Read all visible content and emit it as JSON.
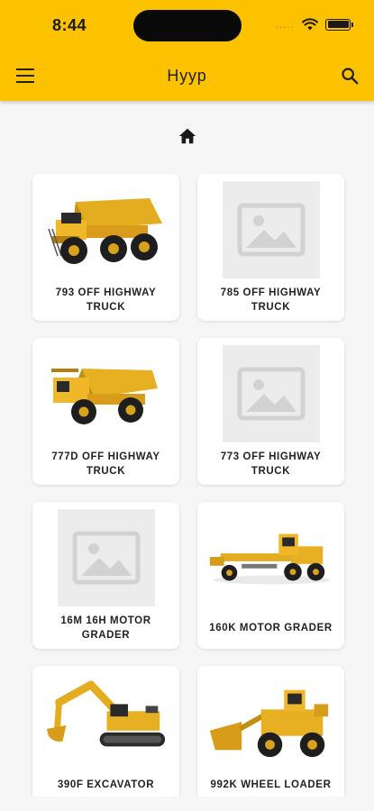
{
  "status_bar": {
    "time": "8:44",
    "signal": "....."
  },
  "app_bar": {
    "title": "Hyyp"
  },
  "grid": {
    "items": [
      {
        "label": "793 OFF HIGHWAY TRUCK",
        "image": "haul-truck"
      },
      {
        "label": "785 OFF HIGHWAY TRUCK",
        "image": "placeholder"
      },
      {
        "label": "777D OFF HIGHWAY TRUCK",
        "image": "haul-truck"
      },
      {
        "label": "773 OFF HIGHWAY TRUCK",
        "image": "placeholder"
      },
      {
        "label": "16M 16H MOTOR GRADER",
        "image": "placeholder"
      },
      {
        "label": "160K MOTOR GRADER",
        "image": "motor-grader"
      },
      {
        "label": "390F EXCAVATOR",
        "image": "excavator"
      },
      {
        "label": "992K WHEEL LOADER",
        "image": "wheel-loader"
      }
    ]
  },
  "colors": {
    "brand": "#FCC200",
    "background": "#F6F6F6",
    "placeholder": "#ECECEC"
  }
}
